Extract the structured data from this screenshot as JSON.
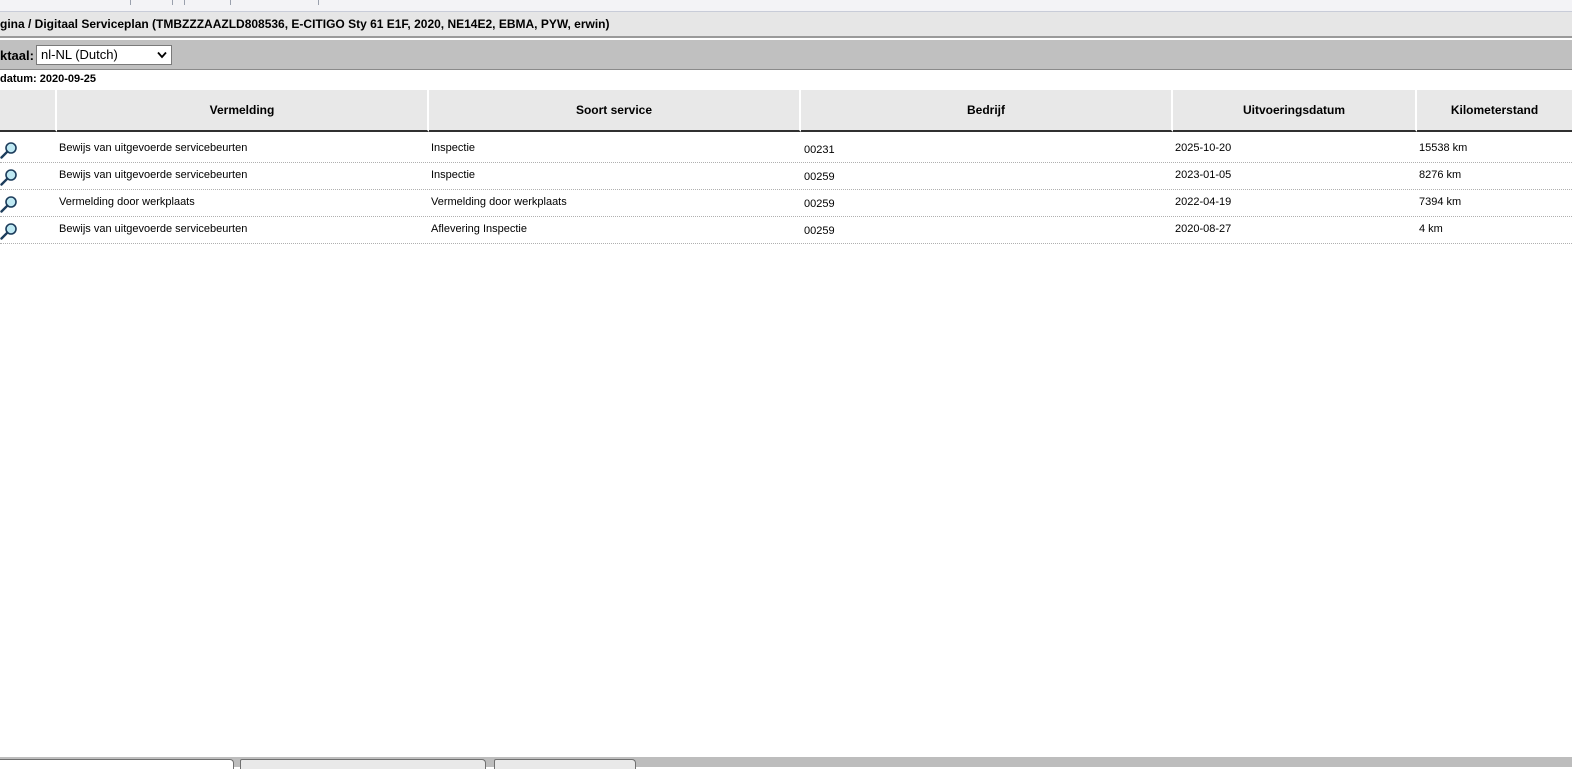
{
  "breadcrumb": "gina / Digitaal Serviceplan (TMBZZZAAZLD808536, E-CITIGO Sty 61 E1F, 2020, NE14E2, EBMA, PYW, erwin)",
  "language": {
    "label": "ktaal:",
    "selected": "nl-NL (Dutch)"
  },
  "date_line": "datum: 2020-09-25",
  "table": {
    "columns": [
      "Vermelding",
      "Soort service",
      "Bedrijf",
      "Uitvoeringsdatum",
      "Kilometerstand"
    ],
    "rows": [
      {
        "vermelding": "Bewijs van uitgevoerde servicebeurten",
        "soort": "Inspectie",
        "bedrijf": "00231",
        "datum": "2025-10-20",
        "km": "15538 km"
      },
      {
        "vermelding": "Bewijs van uitgevoerde servicebeurten",
        "soort": "Inspectie",
        "bedrijf": "00259",
        "datum": "2023-01-05",
        "km": "8276 km"
      },
      {
        "vermelding": "Vermelding door werkplaats",
        "soort": "Vermelding door werkplaats",
        "bedrijf": "00259",
        "datum": "2022-04-19",
        "km": "7394 km"
      },
      {
        "vermelding": "Bewijs van uitgevoerde servicebeurten",
        "soort": "Aflevering Inspectie",
        "bedrijf": "00259",
        "datum": "2020-08-27",
        "km": "4 km"
      }
    ]
  },
  "icons": {
    "row_action": "magnifier-icon",
    "select": "chevron-down-icon"
  }
}
